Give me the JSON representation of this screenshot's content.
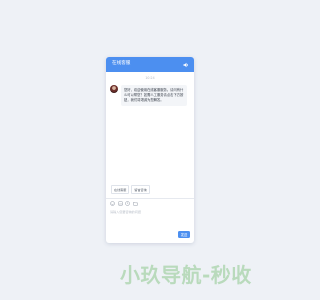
{
  "header": {
    "title": "在线客服",
    "speaker_icon": "speaker-icon"
  },
  "chat": {
    "timestamp": "10:24",
    "message": "您好，欢迎使用在线客服服务。请问有什么可以帮您？如需人工服务请点击下方按钮，我们将竭诚为您解答。"
  },
  "quick_replies": [
    {
      "label": "在线客服"
    },
    {
      "label": "留言咨询"
    }
  ],
  "toolbar": {
    "icons": [
      "emoji-icon",
      "image-icon",
      "clock-icon",
      "folder-icon"
    ]
  },
  "input": {
    "placeholder": "请输入您要咨询的问题"
  },
  "send_label": "发送",
  "watermark": "小玖导航-秒收",
  "colors": {
    "accent": "#4c8ff0",
    "background": "#eef1f6",
    "watermark": "#8fc98e"
  }
}
